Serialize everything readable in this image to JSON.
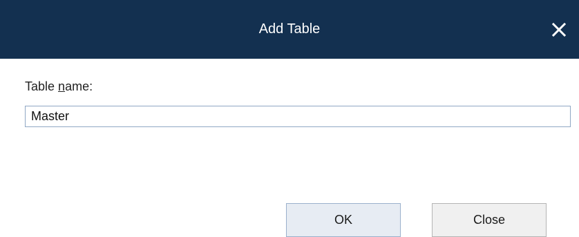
{
  "dialog": {
    "title": "Add Table",
    "close_icon": "close-icon",
    "label_pre": "Table ",
    "label_mnemonic": "n",
    "label_post": "ame:",
    "input_value": "Master",
    "ok_label": "OK",
    "close_label": "Close"
  },
  "colors": {
    "titlebar": "#133050",
    "title_text": "#ffffff",
    "input_border": "#8fa7c4",
    "ok_bg": "#e7ecf3",
    "close_bg": "#f0f0f0"
  }
}
